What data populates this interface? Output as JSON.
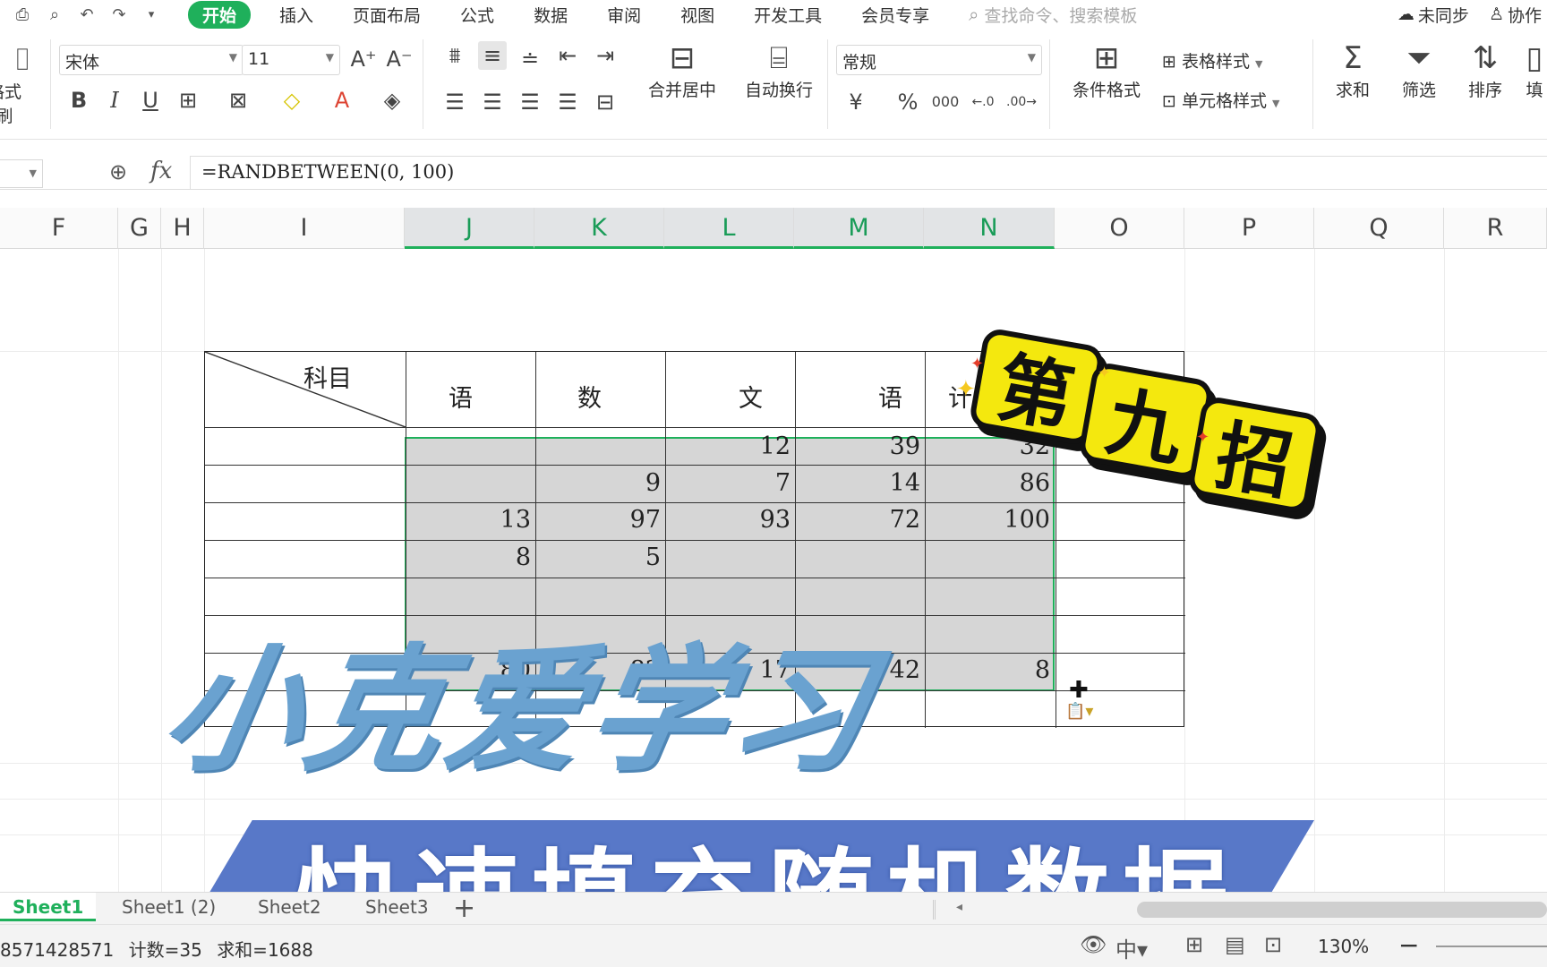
{
  "menubar": {
    "tabs": [
      "开始",
      "插入",
      "页面布局",
      "公式",
      "数据",
      "审阅",
      "视图",
      "开发工具",
      "会员专享"
    ],
    "active_tab": "开始",
    "search_placeholder": "查找命令、搜索模板",
    "sync_status": "未同步",
    "collab_label": "协作"
  },
  "ribbon": {
    "format_painter": "格式刷",
    "font_name": "宋体",
    "font_size": "11",
    "merge_center": "合并居中",
    "wrap_text": "自动换行",
    "number_format": "常规",
    "conditional_format": "条件格式",
    "table_style": "表格样式",
    "cell_style": "单元格样式",
    "sum": "求和",
    "filter": "筛选",
    "sort": "排序",
    "fill": "填"
  },
  "formula_bar": {
    "formula": "=RANDBETWEEN(0, 100)"
  },
  "columns": [
    "F",
    "G",
    "H",
    "I",
    "J",
    "K",
    "L",
    "M",
    "N",
    "O",
    "P",
    "Q",
    "R"
  ],
  "selected_columns": [
    "J",
    "K",
    "L",
    "M",
    "N"
  ],
  "table": {
    "header_corner": "科目",
    "header_fragments": [
      "语",
      "数",
      "文",
      "语",
      "计"
    ],
    "row1": [
      "",
      "",
      "12",
      "39",
      "32"
    ],
    "row2": [
      "",
      "9",
      "7",
      "14",
      "86"
    ],
    "row3": [
      "13",
      "97",
      "93",
      "72",
      "100"
    ],
    "row4": [
      "8",
      "5",
      "",
      "",
      ""
    ],
    "row_last": [
      "80",
      "82",
      "17",
      "42",
      "8"
    ]
  },
  "overlay": {
    "title": "小克爱学习",
    "subtitle": "快速填充随机数据",
    "badge": [
      "第",
      "九",
      "招"
    ]
  },
  "sheets": {
    "tabs": [
      "Sheet1",
      "Sheet1 (2)",
      "Sheet2",
      "Sheet3"
    ],
    "active": "Sheet1"
  },
  "status": {
    "average_fragment": "8571428571",
    "count": "计数=35",
    "sum": "求和=1688",
    "zoom": "130%"
  },
  "colors": {
    "accent": "#1fb05b",
    "title_blue": "#6aa2d0",
    "banner_blue": "#5878c8",
    "badge_yellow": "#f4e80e"
  }
}
